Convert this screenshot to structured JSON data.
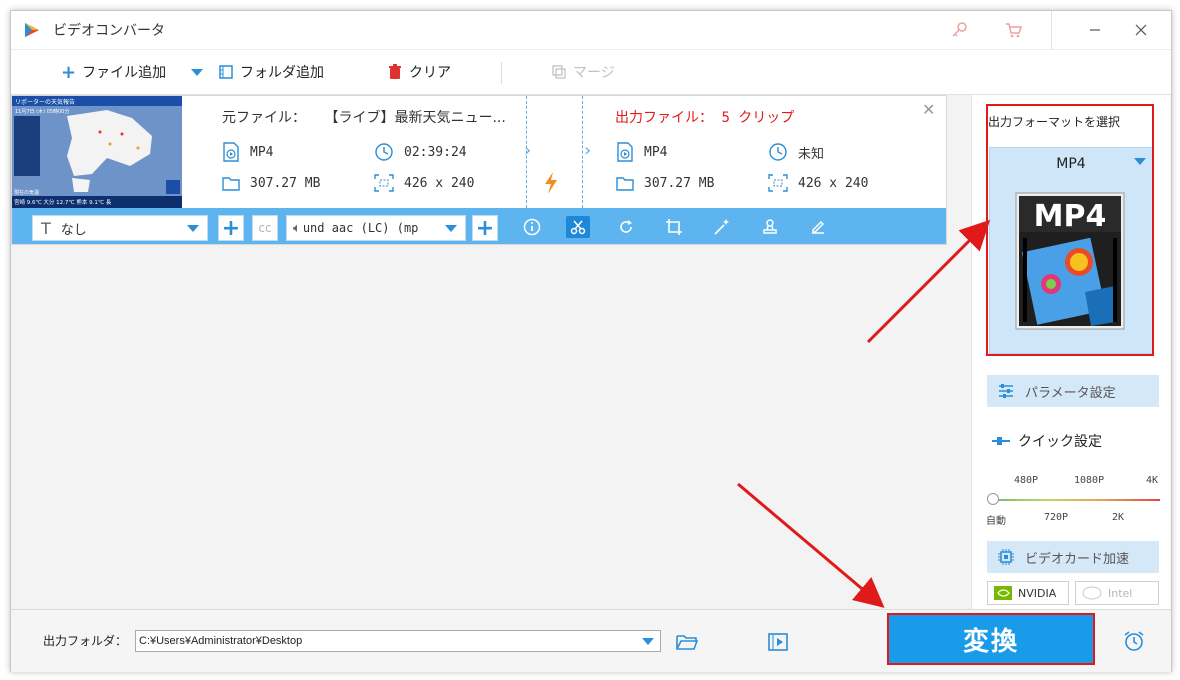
{
  "app": {
    "title": "ビデオコンバータ"
  },
  "toolbar": {
    "add_file": "ファイル追加",
    "add_folder": "フォルダ追加",
    "clear": "クリア",
    "merge": "マージ"
  },
  "file_item": {
    "source_label": "元ファイル：",
    "source_name": "【ライブ】最新天気ニュー...",
    "source_format": "MP4",
    "source_duration": "02:39:24",
    "source_size": "307.27 MB",
    "source_resolution": "426 x 240",
    "output_label": "出力ファイル：",
    "output_name": "5 クリップ",
    "output_format": "MP4",
    "output_duration": "未知",
    "output_size": "307.27 MB",
    "output_resolution": "426 x 240",
    "subtitle_value": "なし",
    "audio_value": "und aac (LC) (mp"
  },
  "thumbnail": {
    "header": "リポーターの天気報告",
    "date": "11月7日 (木) 05時00分",
    "footer": "現在の気温",
    "footer_line": "宮崎 9.6℃  大分 12.7℃  熊本 9.1℃  長"
  },
  "right_panel": {
    "format_label": "出力フォーマットを選択",
    "format_name": "MP4",
    "format_icon_text": "MP4",
    "param_button": "パラメータ設定",
    "quick_label": "クイック設定",
    "ticks_top": [
      "480P",
      "1080P",
      "4K"
    ],
    "ticks_bottom": [
      "自動",
      "720P",
      "2K"
    ],
    "gpu_button": "ビデオカード加速",
    "nvidia": "NVIDIA",
    "intel": "Intel"
  },
  "bottom": {
    "output_folder_label": "出力フォルダ：",
    "output_path": "C:¥Users¥Administrator¥Desktop",
    "convert_button": "変換"
  },
  "colors": {
    "accent": "#1a9bea",
    "control_bar": "#5db4ee",
    "highlight_red": "#e01a1a",
    "output_red": "#e21b1b"
  }
}
